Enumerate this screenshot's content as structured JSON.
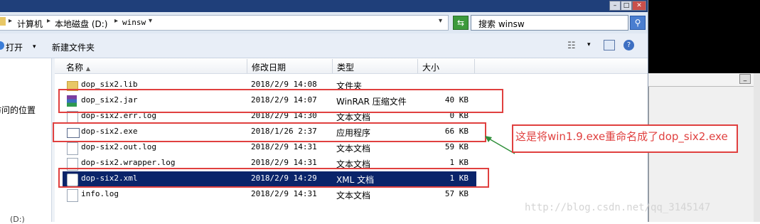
{
  "address": {
    "crumbs": [
      "计算机",
      "本地磁盘 (D:)",
      "winsw"
    ]
  },
  "search": {
    "text": "搜索 winsw"
  },
  "toolbar": {
    "open_label": "打开",
    "new_folder_label": "新建文件夹"
  },
  "nav": {
    "recent_places_partial": "最近访问的位置",
    "partial_bottom": "(D:)"
  },
  "columns": {
    "name": "名称",
    "date": "修改日期",
    "type": "类型",
    "size": "大小"
  },
  "files": [
    {
      "name": "dop_six2.lib",
      "date": "2018/2/9 14:08",
      "type": "文件夹",
      "size": "",
      "icon": "folder-icon"
    },
    {
      "name": "dop_six2.jar",
      "date": "2018/2/9 14:07",
      "type": "WinRAR 压缩文件",
      "size": "40 KB",
      "icon": "winrar-archive-icon"
    },
    {
      "name": "dop-six2.err.log",
      "date": "2018/2/9 14:30",
      "type": "文本文档",
      "size": "0 KB",
      "icon": "text-document-icon"
    },
    {
      "name": "dop-six2.exe",
      "date": "2018/1/26 2:37",
      "type": "应用程序",
      "size": "66 KB",
      "icon": "application-icon"
    },
    {
      "name": "dop-six2.out.log",
      "date": "2018/2/9 14:31",
      "type": "文本文档",
      "size": "59 KB",
      "icon": "text-document-icon"
    },
    {
      "name": "dop-six2.wrapper.log",
      "date": "2018/2/9 14:31",
      "type": "文本文档",
      "size": "1 KB",
      "icon": "text-document-icon"
    },
    {
      "name": "dop-six2.xml",
      "date": "2018/2/9 14:29",
      "type": "XML 文档",
      "size": "1 KB",
      "icon": "xml-document-icon",
      "selected": true
    },
    {
      "name": "info.log",
      "date": "2018/2/9 14:31",
      "type": "文本文档",
      "size": "57 KB",
      "icon": "text-document-icon"
    }
  ],
  "annotation": {
    "text": "这是将win1.9.exe重命名成了dop_six2.exe",
    "color": "#e0403f"
  },
  "watermark": "http://blog.csdn.net/qq_3145147",
  "colors": {
    "selection": "#0a246a",
    "annotation_red": "#e0403f"
  }
}
